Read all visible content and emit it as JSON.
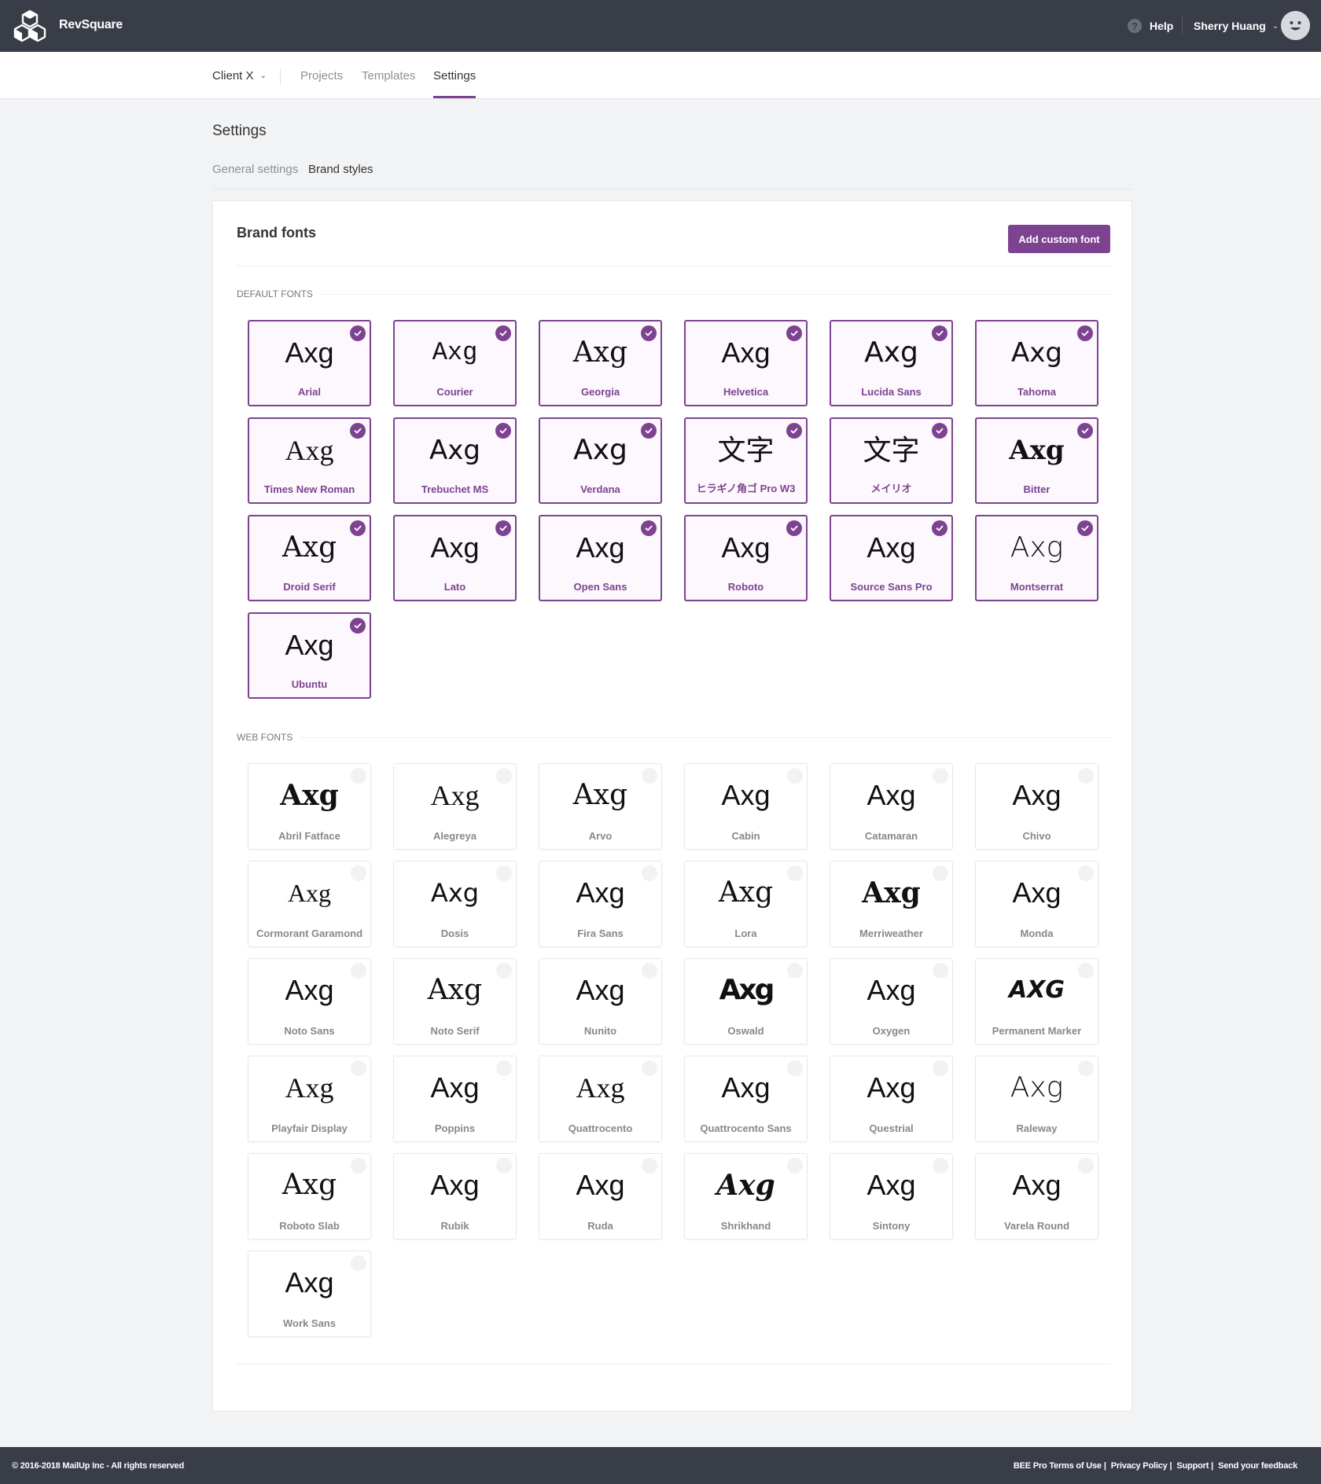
{
  "topbar": {
    "brand": "RevSquare",
    "help_label": "Help",
    "help_glyph": "?",
    "user_name": "Sherry Huang"
  },
  "subnav": {
    "client": "Client X",
    "tabs": [
      "Projects",
      "Templates",
      "Settings"
    ],
    "active_tab": "Settings"
  },
  "page": {
    "title": "Settings",
    "tabs": [
      "General settings",
      "Brand styles"
    ],
    "active_tab": "Brand styles"
  },
  "brand_fonts": {
    "title": "Brand fonts",
    "add_button": "Add custom font",
    "default_label": "Default fonts",
    "web_label": "Web fonts",
    "default_fonts": [
      {
        "name": "Arial",
        "sample": "Axg",
        "selected": true
      },
      {
        "name": "Courier",
        "sample": "Axg",
        "selected": true
      },
      {
        "name": "Georgia",
        "sample": "Axg",
        "selected": true
      },
      {
        "name": "Helvetica",
        "sample": "Axg",
        "selected": true
      },
      {
        "name": "Lucida Sans",
        "sample": "Axg",
        "selected": true
      },
      {
        "name": "Tahoma",
        "sample": "Axg",
        "selected": true
      },
      {
        "name": "Times New Roman",
        "sample": "Axg",
        "selected": true
      },
      {
        "name": "Trebuchet MS",
        "sample": "Axg",
        "selected": true
      },
      {
        "name": "Verdana",
        "sample": "Axg",
        "selected": true
      },
      {
        "name": "ヒラギノ角ゴ Pro W3",
        "sample": "文字",
        "selected": true
      },
      {
        "name": "メイリオ",
        "sample": "文字",
        "selected": true
      },
      {
        "name": "Bitter",
        "sample": "Axg",
        "selected": true
      },
      {
        "name": "Droid Serif",
        "sample": "Axg",
        "selected": true
      },
      {
        "name": "Lato",
        "sample": "Axg",
        "selected": true
      },
      {
        "name": "Open Sans",
        "sample": "Axg",
        "selected": true
      },
      {
        "name": "Roboto",
        "sample": "Axg",
        "selected": true
      },
      {
        "name": "Source Sans Pro",
        "sample": "Axg",
        "selected": true
      },
      {
        "name": "Montserrat",
        "sample": "Axg",
        "selected": true
      },
      {
        "name": "Ubuntu",
        "sample": "Axg",
        "selected": true
      }
    ],
    "web_fonts": [
      {
        "name": "Abril Fatface",
        "sample": "Axg",
        "selected": false
      },
      {
        "name": "Alegreya",
        "sample": "Axg",
        "selected": false
      },
      {
        "name": "Arvo",
        "sample": "Axg",
        "selected": false
      },
      {
        "name": "Cabin",
        "sample": "Axg",
        "selected": false
      },
      {
        "name": "Catamaran",
        "sample": "Axg",
        "selected": false
      },
      {
        "name": "Chivo",
        "sample": "Axg",
        "selected": false
      },
      {
        "name": "Cormorant Garamond",
        "sample": "Axg",
        "selected": false
      },
      {
        "name": "Dosis",
        "sample": "Axg",
        "selected": false
      },
      {
        "name": "Fira Sans",
        "sample": "Axg",
        "selected": false
      },
      {
        "name": "Lora",
        "sample": "Axg",
        "selected": false
      },
      {
        "name": "Merriweather",
        "sample": "Axg",
        "selected": false
      },
      {
        "name": "Monda",
        "sample": "Axg",
        "selected": false
      },
      {
        "name": "Noto Sans",
        "sample": "Axg",
        "selected": false
      },
      {
        "name": "Noto Serif",
        "sample": "Axg",
        "selected": false
      },
      {
        "name": "Nunito",
        "sample": "Axg",
        "selected": false
      },
      {
        "name": "Oswald",
        "sample": "Axg",
        "selected": false
      },
      {
        "name": "Oxygen",
        "sample": "Axg",
        "selected": false
      },
      {
        "name": "Permanent Marker",
        "sample": "AXG",
        "selected": false
      },
      {
        "name": "Playfair Display",
        "sample": "Axg",
        "selected": false
      },
      {
        "name": "Poppins",
        "sample": "Axg",
        "selected": false
      },
      {
        "name": "Quattrocento",
        "sample": "Axg",
        "selected": false
      },
      {
        "name": "Quattrocento Sans",
        "sample": "Axg",
        "selected": false
      },
      {
        "name": "Questrial",
        "sample": "Axg",
        "selected": false
      },
      {
        "name": "Raleway",
        "sample": "Axg",
        "selected": false
      },
      {
        "name": "Roboto Slab",
        "sample": "Axg",
        "selected": false
      },
      {
        "name": "Rubik",
        "sample": "Axg",
        "selected": false
      },
      {
        "name": "Ruda",
        "sample": "Axg",
        "selected": false
      },
      {
        "name": "Shrikhand",
        "sample": "Axg",
        "selected": false
      },
      {
        "name": "Sintony",
        "sample": "Axg",
        "selected": false
      },
      {
        "name": "Varela Round",
        "sample": "Axg",
        "selected": false
      },
      {
        "name": "Work Sans",
        "sample": "Axg",
        "selected": false
      }
    ]
  },
  "footer": {
    "copyright": "© 2016-2018 MailUp Inc - All rights reserved",
    "links": [
      "BEE Pro Terms of Use",
      "Privacy Policy",
      "Support",
      "Send your feedback"
    ]
  },
  "colors": {
    "accent": "#7d4390",
    "topbar": "#393d47",
    "page_bg": "#f2f3f5"
  }
}
